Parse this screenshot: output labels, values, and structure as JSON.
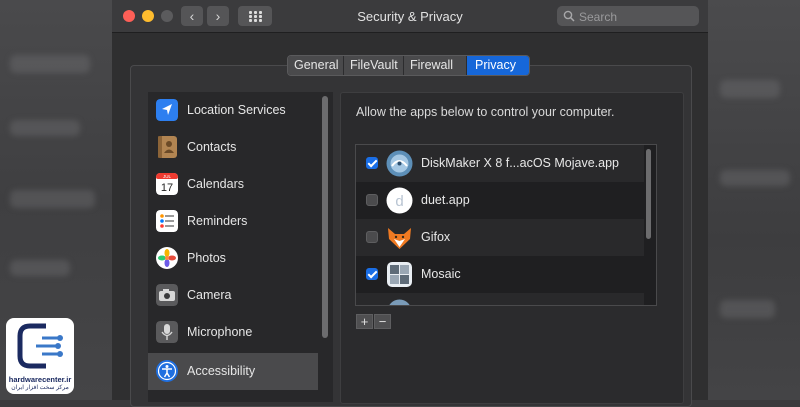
{
  "window": {
    "title": "Security & Privacy",
    "search_placeholder": "Search"
  },
  "tabs": [
    {
      "label": "General",
      "active": false
    },
    {
      "label": "FileVault",
      "active": false
    },
    {
      "label": "Firewall",
      "active": false
    },
    {
      "label": "Privacy",
      "active": true
    }
  ],
  "sidebar": {
    "items": [
      {
        "label": "Location Services",
        "icon": "location-arrow-icon",
        "selected": false
      },
      {
        "label": "Contacts",
        "icon": "contacts-book-icon",
        "selected": false
      },
      {
        "label": "Calendars",
        "icon": "calendar-icon",
        "selected": false
      },
      {
        "label": "Reminders",
        "icon": "reminders-list-icon",
        "selected": false
      },
      {
        "label": "Photos",
        "icon": "photos-flower-icon",
        "selected": false
      },
      {
        "label": "Camera",
        "icon": "camera-icon",
        "selected": false
      },
      {
        "label": "Microphone",
        "icon": "microphone-icon",
        "selected": false
      },
      {
        "label": "Accessibility",
        "icon": "accessibility-icon",
        "selected": true
      }
    ],
    "calendar_month": "JUL",
    "calendar_day": "17"
  },
  "main": {
    "allow_text": "Allow the apps below to control your computer.",
    "apps": [
      {
        "label": "DiskMaker X 8 f...acOS Mojave.app",
        "checked": true,
        "icon": "diskmaker-icon"
      },
      {
        "label": "duet.app",
        "checked": false,
        "icon": "duet-icon"
      },
      {
        "label": "Gifox",
        "checked": false,
        "icon": "gifox-fox-icon"
      },
      {
        "label": "Mosaic",
        "checked": true,
        "icon": "mosaic-grid-icon"
      }
    ],
    "add_label": "+",
    "remove_label": "−"
  },
  "watermark": {
    "brand": "hardwarecenter.ir",
    "subtitle": "مرکز سخت افزار ایران"
  },
  "colors": {
    "accent": "#1667d9",
    "close": "#fe5f57",
    "minimize": "#febc2e"
  }
}
